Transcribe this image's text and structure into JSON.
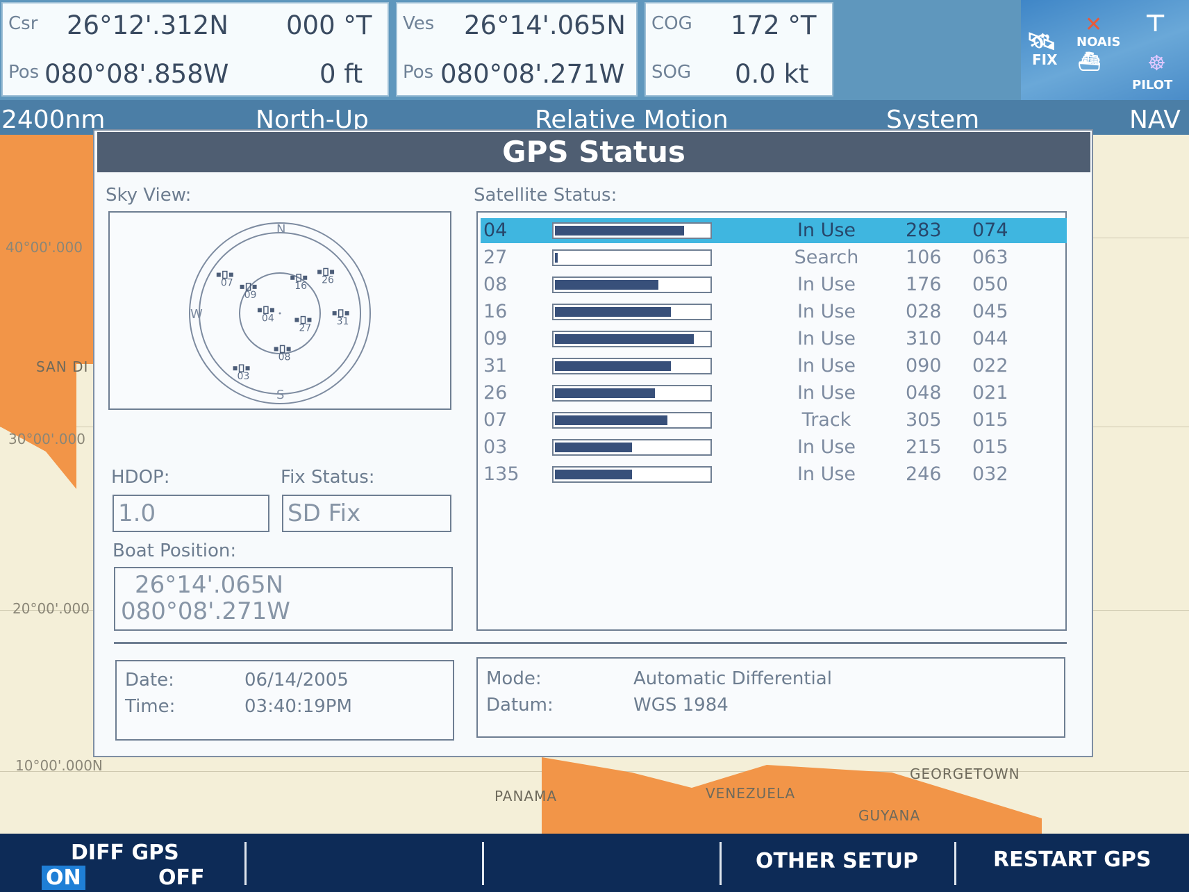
{
  "top_bar": {
    "csr_label": "Csr",
    "csr_lat": "26°12'.312N",
    "csr_heading": "000 °T",
    "csr_pos_label": "Pos",
    "csr_lon": "080°08'.858W",
    "csr_depth": "0 ft",
    "ves_label": "Ves",
    "ves_lat": "26°14'.065N",
    "ves_pos_label": "Pos",
    "ves_lon": "080°08'.271W",
    "cog_label": "COG",
    "cog_value": "172 °T",
    "sog_label": "SOG",
    "sog_value": "0.0 kt",
    "status_icons": {
      "fix_label": "FIX",
      "noais_label": "NOAIS",
      "pilot_label": "PILOT"
    }
  },
  "sub_header": {
    "range": "2400nm",
    "orientation": "North-Up",
    "motion": "Relative Motion",
    "menu": "System",
    "mode": "NAV"
  },
  "chart": {
    "lat_labels": [
      "40°00'.000",
      "30°00'.000",
      "20°00'.000",
      "10°00'.000N"
    ],
    "places": [
      "SAN DI",
      "PANAMA",
      "VENEZUELA",
      "GEORGETOWN",
      "GUYANA"
    ],
    "land_color": "#f29548",
    "water_color": "#f4efd8"
  },
  "dialog": {
    "title": "GPS Status",
    "sky_view_label": "Sky View:",
    "satellite_status_label": "Satellite Status:",
    "sky": {
      "cardinals": [
        "N",
        "S",
        "W"
      ],
      "satellites": [
        {
          "id": "07",
          "az": 305,
          "el": 15
        },
        {
          "id": "09",
          "az": 310,
          "el": 44
        },
        {
          "id": "16",
          "az": 28,
          "el": 45
        },
        {
          "id": "26",
          "az": 48,
          "el": 21
        },
        {
          "id": "04",
          "az": 283,
          "el": 74
        },
        {
          "id": "27",
          "az": 106,
          "el": 63
        },
        {
          "id": "31",
          "az": 90,
          "el": 22
        },
        {
          "id": "08",
          "az": 176,
          "el": 50
        },
        {
          "id": "03",
          "az": 215,
          "el": 15
        }
      ]
    },
    "satellites": [
      {
        "prn": "04",
        "signal": 0.84,
        "status": "In Use",
        "azimuth": "283",
        "elevation": "074"
      },
      {
        "prn": "27",
        "signal": 0.02,
        "status": "Search",
        "azimuth": "106",
        "elevation": "063"
      },
      {
        "prn": "08",
        "signal": 0.67,
        "status": "In Use",
        "azimuth": "176",
        "elevation": "050"
      },
      {
        "prn": "16",
        "signal": 0.75,
        "status": "In Use",
        "azimuth": "028",
        "elevation": "045"
      },
      {
        "prn": "09",
        "signal": 0.9,
        "status": "In Use",
        "azimuth": "310",
        "elevation": "044"
      },
      {
        "prn": "31",
        "signal": 0.75,
        "status": "In Use",
        "azimuth": "090",
        "elevation": "022"
      },
      {
        "prn": "26",
        "signal": 0.65,
        "status": "In Use",
        "azimuth": "048",
        "elevation": "021"
      },
      {
        "prn": "07",
        "signal": 0.73,
        "status": "Track",
        "azimuth": "305",
        "elevation": "015"
      },
      {
        "prn": "03",
        "signal": 0.5,
        "status": "In Use",
        "azimuth": "215",
        "elevation": "015"
      },
      {
        "prn": "135",
        "signal": 0.5,
        "status": "In Use",
        "azimuth": "246",
        "elevation": "032"
      }
    ],
    "selected_row": 0,
    "hdop_label": "HDOP:",
    "hdop_value": "1.0",
    "fix_status_label": "Fix Status:",
    "fix_status_value": "SD Fix",
    "boat_position_label": "Boat Position:",
    "boat_lat": "26°14'.065N",
    "boat_lon": "080°08'.271W",
    "date_label": "Date:",
    "date_value": "06/14/2005",
    "time_label": "Time:",
    "time_value": "03:40:19PM",
    "mode_label": "Mode:",
    "mode_value": "Automatic Differential",
    "datum_label": "Datum:",
    "datum_value": "WGS 1984"
  },
  "soft_keys": {
    "diff_gps_label": "DIFF GPS",
    "diff_on": "ON",
    "diff_off": "OFF",
    "other_setup": "OTHER SETUP",
    "restart_gps": "RESTART GPS"
  },
  "colors": {
    "selected_row": "#3fb6e0",
    "signal_bar": "#38507a",
    "softbar": "#0d2b57",
    "on_highlight": "#1f7fd6"
  }
}
